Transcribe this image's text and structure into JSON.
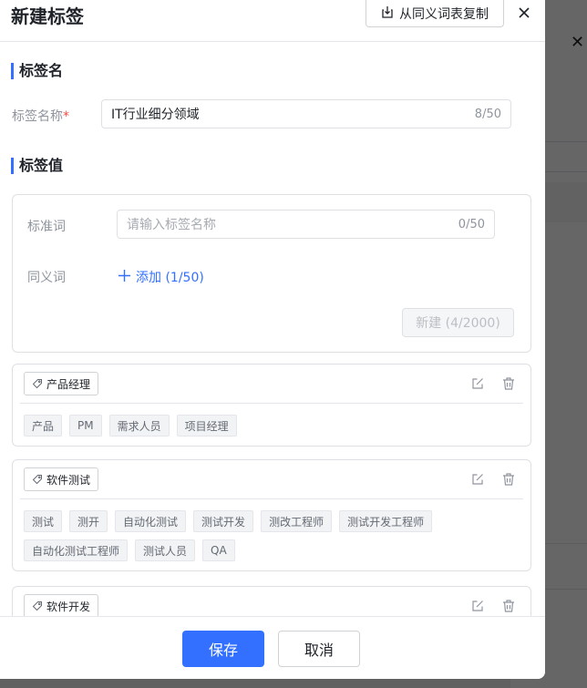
{
  "dialog": {
    "title": "新建标签",
    "copy_button_label": "从同义词表复制",
    "close_icon": "close-icon"
  },
  "section_name": {
    "title": "标签名",
    "field_label": "标签名称",
    "required_mark": "*",
    "value": "IT行业细分领域",
    "counter": "8/50"
  },
  "section_values": {
    "title": "标签值",
    "standard_label": "标准词",
    "standard_placeholder": "请输入标签名称",
    "standard_counter": "0/50",
    "synonym_label": "同义词",
    "add_link_label": "添加 (1/50)",
    "new_button_label": "新建 (4/2000)"
  },
  "tag_cards": [
    {
      "name": "产品经理",
      "synonyms": [
        "产品",
        "PM",
        "需求人员",
        "项目经理"
      ]
    },
    {
      "name": "软件测试",
      "synonyms": [
        "测试",
        "测开",
        "自动化测试",
        "测试开发",
        "测改工程师",
        "测试开发工程师",
        "自动化测试工程师",
        "测试人员",
        "QA"
      ]
    },
    {
      "name": "软件开发",
      "synonyms": []
    }
  ],
  "footer": {
    "save_label": "保存",
    "cancel_label": "取消"
  },
  "colors": {
    "accent": "#3370ff",
    "required": "#f54a45"
  }
}
